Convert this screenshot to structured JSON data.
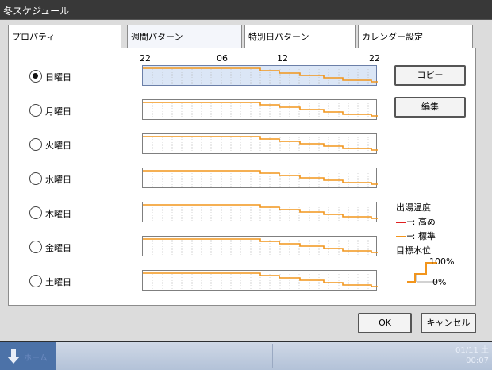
{
  "window": {
    "title": "冬スケジュール"
  },
  "tabs": [
    {
      "label": "プロパティ"
    },
    {
      "label": "週間パターン"
    },
    {
      "label": "特別日パターン"
    },
    {
      "label": "カレンダー設定"
    }
  ],
  "time_scale": [
    "22",
    "06",
    "12",
    "22"
  ],
  "days": [
    {
      "label": "日曜日",
      "selected": true
    },
    {
      "label": "月曜日",
      "selected": false
    },
    {
      "label": "火曜日",
      "selected": false
    },
    {
      "label": "水曜日",
      "selected": false
    },
    {
      "label": "木曜日",
      "selected": false
    },
    {
      "label": "金曜日",
      "selected": false
    },
    {
      "label": "土曜日",
      "selected": false
    }
  ],
  "side": {
    "copy_label": "コピー",
    "edit_label": "編集"
  },
  "legend": {
    "title": "出湯温度",
    "high": "─: 高め",
    "standard": "─: 標準",
    "level_title": "目標水位",
    "pct_high": "100%",
    "pct_low": "0%"
  },
  "colors": {
    "standard": "#f2951c",
    "high": "#e02020"
  },
  "footer": {
    "ok_label": "OK",
    "cancel_label": "キャンセル"
  },
  "taskbar": {
    "start_label": "ホーム",
    "date": "01/11 土",
    "time": "00:07"
  }
}
